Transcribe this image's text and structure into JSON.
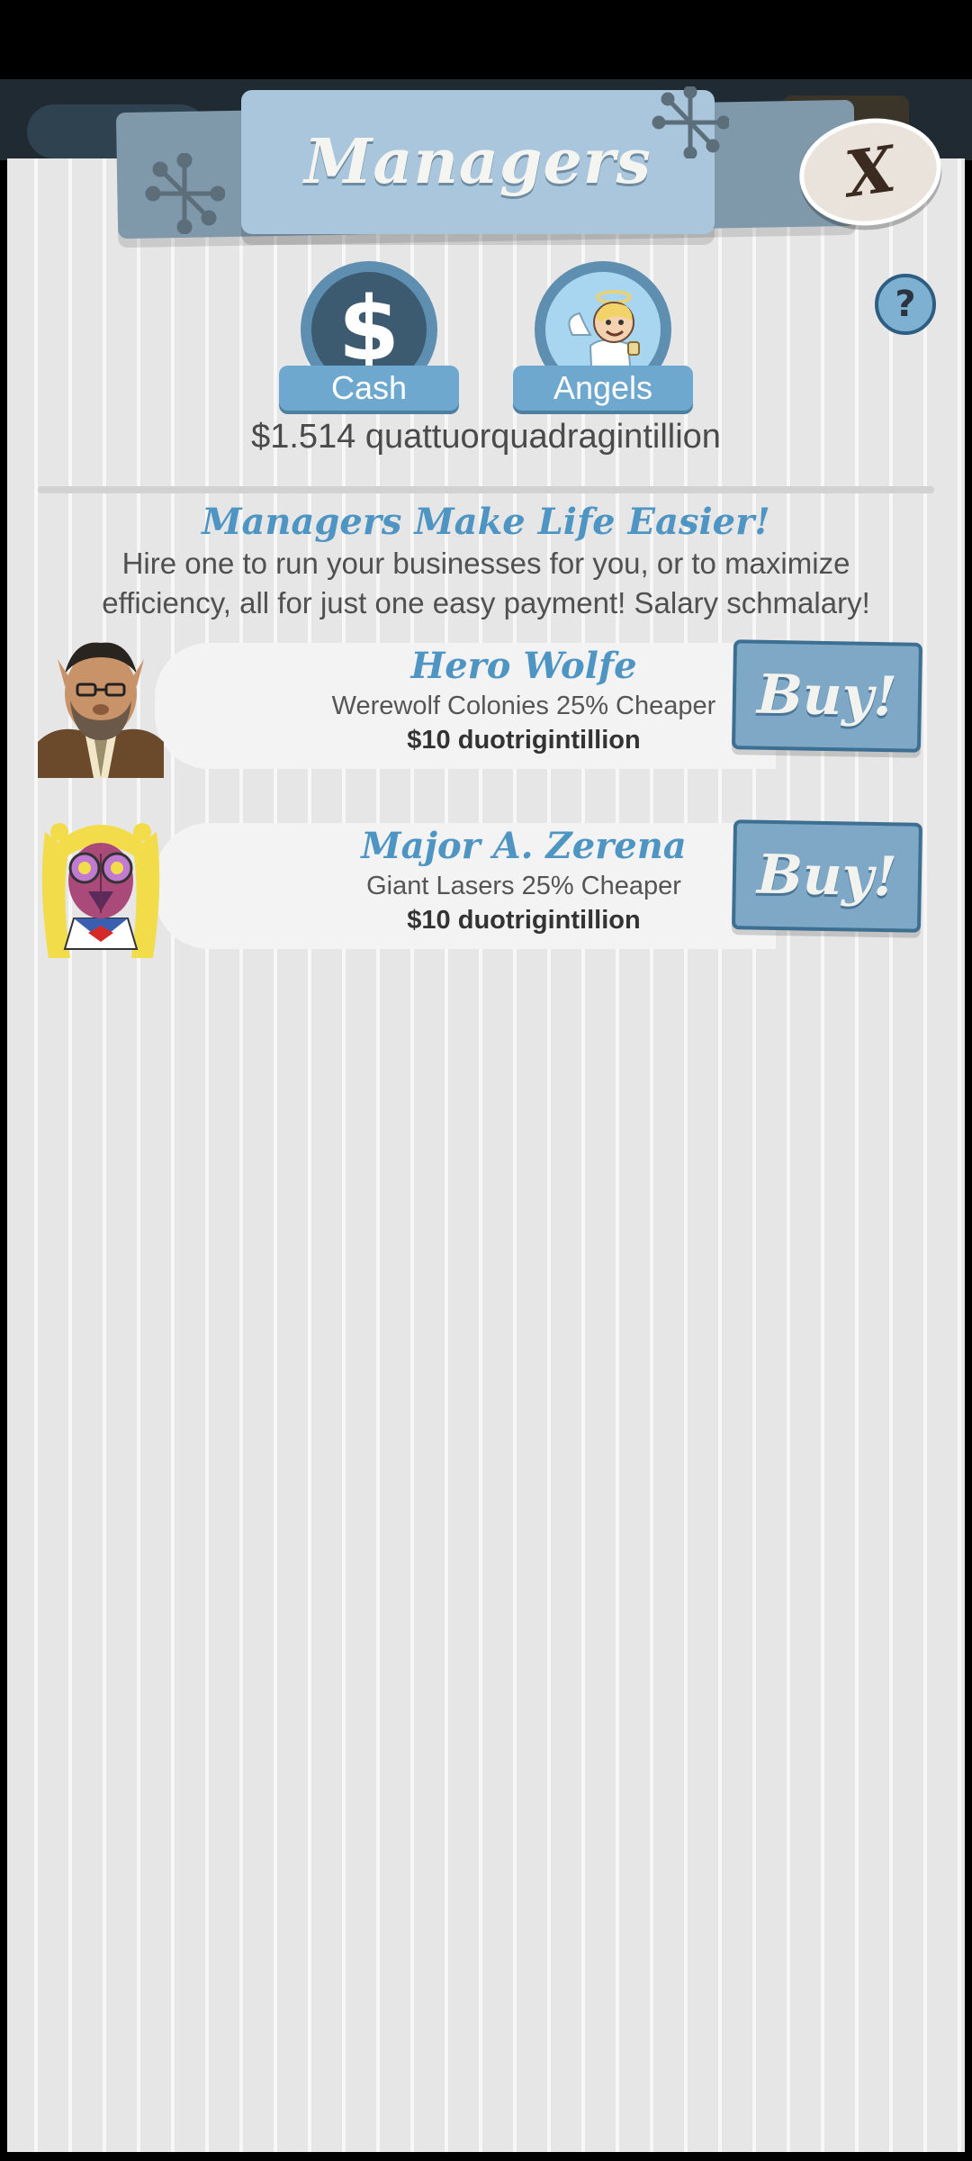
{
  "header": {
    "title": "Managers"
  },
  "close": {
    "label": "X"
  },
  "help": {
    "label": "?"
  },
  "tabs": [
    {
      "label": "Cash",
      "icon": "dollar-icon",
      "glyph": "$"
    },
    {
      "label": "Angels",
      "icon": "angel-icon"
    }
  ],
  "cash_amount": "$1.514 quattuorquadragintillion",
  "intro": {
    "title": "Managers Make Life Easier!",
    "text": "Hire one to run your businesses for you, or to maximize efficiency, all for just one easy payment! Salary schmalary!"
  },
  "managers": [
    {
      "name": "Hero Wolfe",
      "effect": "Werewolf Colonies 25% Cheaper",
      "cost": "$10 duotrigintillion",
      "buy_label": "Buy!"
    },
    {
      "name": "Major A. Zerena",
      "effect": "Giant Lasers 25% Cheaper",
      "cost": "$10 duotrigintillion",
      "buy_label": "Buy!"
    }
  ],
  "colors": {
    "accent": "#4e95c4",
    "button": "#7ea8c6",
    "banner": "#a9c6dc"
  }
}
